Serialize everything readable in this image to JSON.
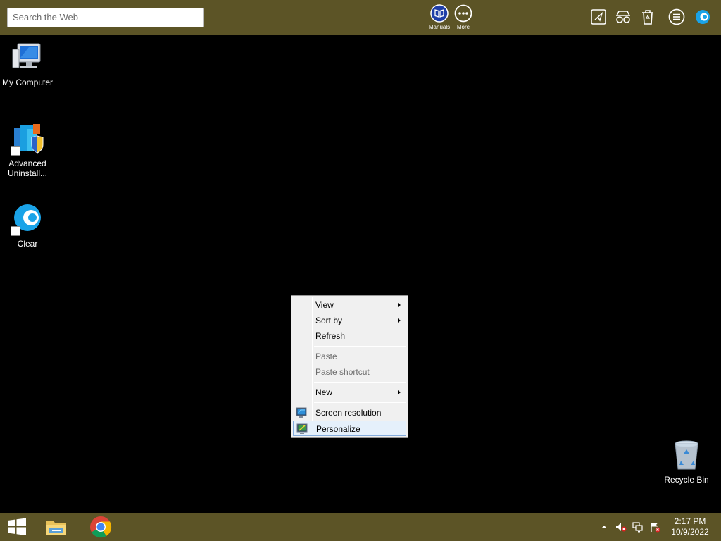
{
  "toolbar": {
    "search_placeholder": "Search the Web",
    "manuals_label": "Manuals",
    "more_label": "More",
    "right_icons": [
      "send-icon",
      "glasses-icon",
      "trash-icon",
      "menu-icon",
      "app-logo-icon"
    ]
  },
  "desktop": {
    "icons": [
      {
        "label": "My Computer",
        "icon": "computer-icon"
      },
      {
        "label": "Advanced Uninstall...",
        "line1": "Advanced",
        "line2": "Uninstall...",
        "icon": "uninstaller-icon"
      },
      {
        "label": "Clear",
        "icon": "clear-icon"
      },
      {
        "label": "Recycle Bin",
        "icon": "recycle-bin-icon"
      }
    ]
  },
  "context_menu": {
    "items": [
      {
        "label": "View",
        "submenu": true,
        "enabled": true,
        "icon": ""
      },
      {
        "label": "Sort by",
        "submenu": true,
        "enabled": true,
        "icon": ""
      },
      {
        "label": "Refresh",
        "submenu": false,
        "enabled": true,
        "icon": ""
      },
      {
        "label": "Paste",
        "submenu": false,
        "enabled": false,
        "icon": ""
      },
      {
        "label": "Paste shortcut",
        "submenu": false,
        "enabled": false,
        "icon": ""
      },
      {
        "label": "New",
        "submenu": true,
        "enabled": true,
        "icon": ""
      },
      {
        "label": "Screen resolution",
        "submenu": false,
        "enabled": true,
        "icon": "screen-resolution-icon"
      },
      {
        "label": "Personalize",
        "submenu": false,
        "enabled": true,
        "highlighted": true,
        "icon": "personalize-icon"
      }
    ]
  },
  "taskbar": {
    "apps": [
      "windows-start-icon",
      "file-explorer-icon",
      "chrome-icon"
    ],
    "tray_icons": [
      "show-hidden-icons-chevron",
      "volume-muted-icon",
      "network-icon",
      "action-center-flag-icon"
    ],
    "time": "2:17 PM",
    "date": "10/9/2022"
  },
  "colors": {
    "bar_background": "#5c5426",
    "desktop_background": "#000000",
    "menu_highlight": "#e5f0fb",
    "menu_highlight_border": "#84acdd",
    "accent_blue": "#1a5fc7"
  }
}
